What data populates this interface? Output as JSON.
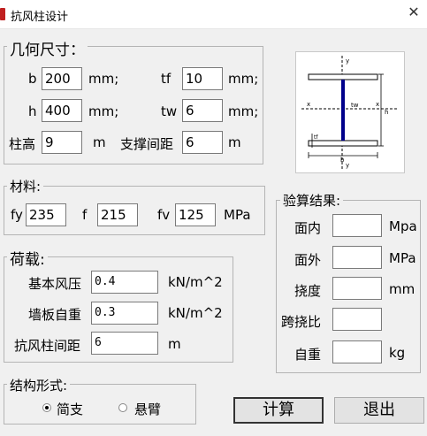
{
  "window": {
    "title": "抗风柱设计",
    "close_glyph": "✕"
  },
  "geometry": {
    "title": "几何尺寸：",
    "b": {
      "label": "b",
      "value": "200",
      "unit": "mm;"
    },
    "tf": {
      "label": "tf",
      "value": "10",
      "unit": "mm;"
    },
    "h": {
      "label": "h",
      "value": "400",
      "unit": "mm;"
    },
    "tw": {
      "label": "tw",
      "value": "6",
      "unit": "mm;"
    },
    "height": {
      "label": "柱高",
      "value": "9",
      "unit": "m"
    },
    "brace": {
      "label": "支撑间距",
      "value": "6",
      "unit": "m"
    }
  },
  "material": {
    "title": "材料:",
    "fy": {
      "label": "fy",
      "value": "235"
    },
    "f": {
      "label": "f",
      "value": "215"
    },
    "fv": {
      "label": "fv",
      "value": "125"
    },
    "unit": "MPa"
  },
  "load": {
    "title": "荷载:",
    "wind": {
      "label": "基本风压",
      "value": "0.4",
      "unit": "kN/m^2"
    },
    "wall": {
      "label": "墙板自重",
      "value": "0.3",
      "unit": "kN/m^2"
    },
    "spacing": {
      "label": "抗风柱间距",
      "value": "6",
      "unit": "m"
    }
  },
  "structure": {
    "title": "结构形式:",
    "options": [
      {
        "label": "简支",
        "selected": true
      },
      {
        "label": "悬臂",
        "selected": false
      }
    ]
  },
  "result": {
    "title": "验算结果:",
    "in_plane": {
      "label": "面内",
      "value": "",
      "unit": "Mpa"
    },
    "out_plane": {
      "label": "面外",
      "value": "",
      "unit": "MPa"
    },
    "deflection": {
      "label": "挠度",
      "value": "",
      "unit": "mm"
    },
    "span_ratio": {
      "label": "跨挠比",
      "value": "",
      "unit": ""
    },
    "self_weight": {
      "label": "自重",
      "value": "",
      "unit": "kg"
    }
  },
  "section_diagram": {
    "labels": {
      "y": "y",
      "x": "x",
      "tw": "tw",
      "tf": "tf",
      "b": "b",
      "h": "h"
    },
    "colors": {
      "web": "#00008b",
      "outline": "#000000"
    }
  },
  "buttons": {
    "calculate": "计算",
    "exit": "退出"
  }
}
